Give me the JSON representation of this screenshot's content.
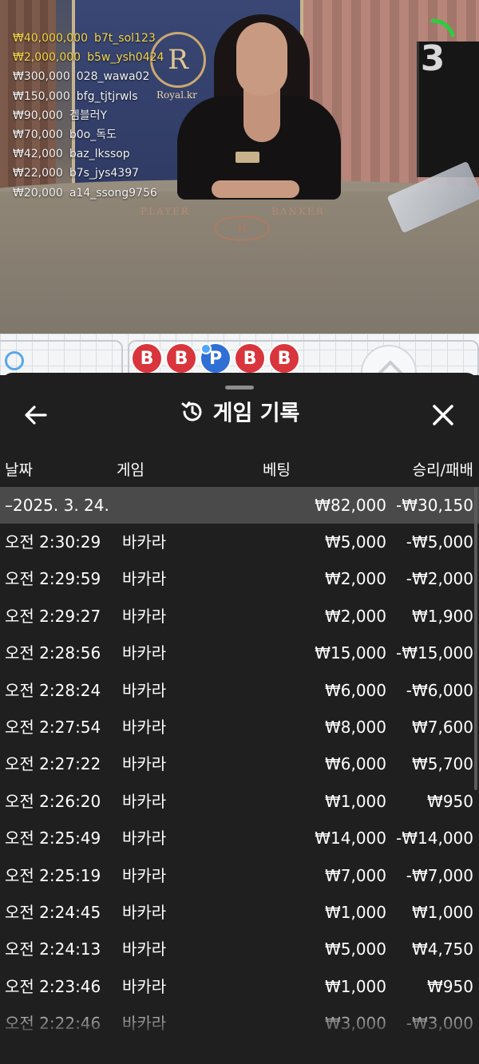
{
  "stream": {
    "countdown": "3",
    "crest_letter": "R",
    "crest_label": "Royal.kr",
    "table_player": "PLAYER",
    "table_banker": "BANKER",
    "table_logo": "R",
    "bet_feed": [
      {
        "amount": "₩40,000,000",
        "user": "b7t_sol123",
        "highlight": true
      },
      {
        "amount": "₩2,000,000",
        "user": "b5w_ysh0424",
        "highlight": true
      },
      {
        "amount": "₩300,000",
        "user": "028_wawa02",
        "highlight": false
      },
      {
        "amount": "₩150,000",
        "user": "bfg_tjtjrwls",
        "highlight": false
      },
      {
        "amount": "₩90,000",
        "user": "겜블러Y",
        "highlight": false
      },
      {
        "amount": "₩70,000",
        "user": "b0o_독도",
        "highlight": false
      },
      {
        "amount": "₩42,000",
        "user": "baz_lkssop",
        "highlight": false
      },
      {
        "amount": "₩22,000",
        "user": "b7s_jys4397",
        "highlight": false
      },
      {
        "amount": "₩20,000",
        "user": "a14_ssong9756",
        "highlight": false
      }
    ]
  },
  "road": {
    "beads": [
      "B",
      "B",
      "P",
      "B",
      "B"
    ]
  },
  "history": {
    "title": "게임 기록",
    "columns": {
      "date": "날짜",
      "game": "게임",
      "bet": "베팅",
      "result": "승리/패배"
    },
    "date_group": {
      "date": "–2025. 3. 24.",
      "bet_total": "₩82,000",
      "result_total": "-₩30,150"
    },
    "rows": [
      {
        "time": "오전 2:30:29",
        "game": "바카라",
        "bet": "₩5,000",
        "result": "-₩5,000"
      },
      {
        "time": "오전 2:29:59",
        "game": "바카라",
        "bet": "₩2,000",
        "result": "-₩2,000"
      },
      {
        "time": "오전 2:29:27",
        "game": "바카라",
        "bet": "₩2,000",
        "result": "₩1,900"
      },
      {
        "time": "오전 2:28:56",
        "game": "바카라",
        "bet": "₩15,000",
        "result": "-₩15,000"
      },
      {
        "time": "오전 2:28:24",
        "game": "바카라",
        "bet": "₩6,000",
        "result": "-₩6,000"
      },
      {
        "time": "오전 2:27:54",
        "game": "바카라",
        "bet": "₩8,000",
        "result": "₩7,600"
      },
      {
        "time": "오전 2:27:22",
        "game": "바카라",
        "bet": "₩6,000",
        "result": "₩5,700"
      },
      {
        "time": "오전 2:26:20",
        "game": "바카라",
        "bet": "₩1,000",
        "result": "₩950"
      },
      {
        "time": "오전 2:25:49",
        "game": "바카라",
        "bet": "₩14,000",
        "result": "-₩14,000"
      },
      {
        "time": "오전 2:25:19",
        "game": "바카라",
        "bet": "₩7,000",
        "result": "-₩7,000"
      },
      {
        "time": "오전 2:24:45",
        "game": "바카라",
        "bet": "₩1,000",
        "result": "₩1,000"
      },
      {
        "time": "오전 2:24:13",
        "game": "바카라",
        "bet": "₩5,000",
        "result": "₩4,750"
      },
      {
        "time": "오전 2:23:46",
        "game": "바카라",
        "bet": "₩1,000",
        "result": "₩950"
      },
      {
        "time": "오전 2:22:46",
        "game": "바카라",
        "bet": "₩3,000",
        "result": "-₩3,000"
      }
    ]
  },
  "icons": {
    "back": "arrow-left-icon",
    "close": "close-icon",
    "history": "history-icon",
    "road_scroll": "chevron-up-icon"
  },
  "colors": {
    "sheet_bg": "#1f1f1f",
    "date_row_bg": "#4a4a4a",
    "banker_red": "#d8353c",
    "player_blue": "#2f6fd6",
    "feed_gold": "#f5d547",
    "countdown_ring": "#2ecc40"
  }
}
